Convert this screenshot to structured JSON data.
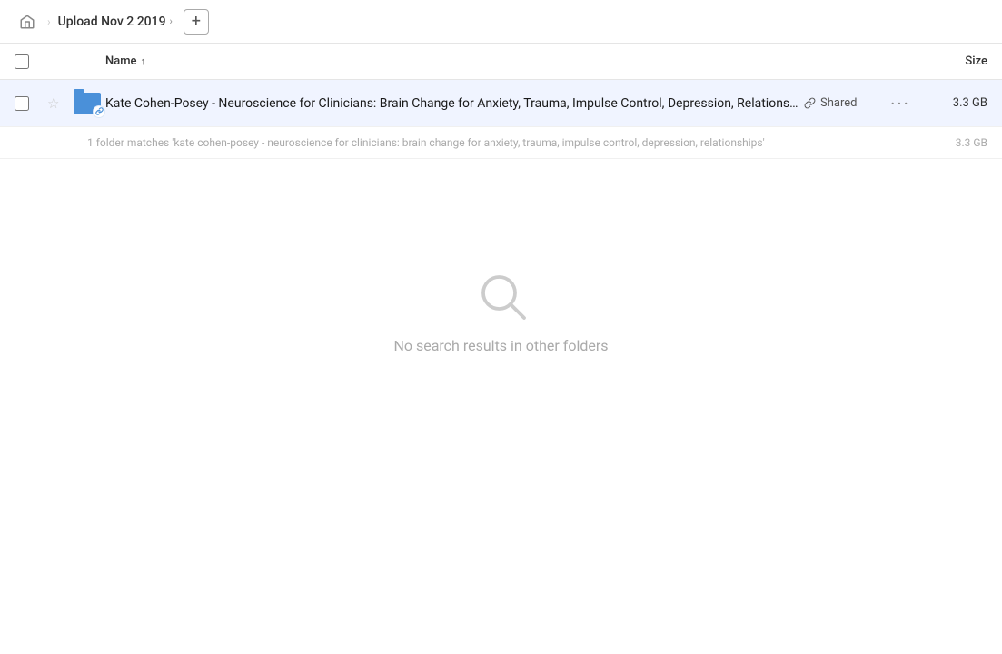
{
  "header": {
    "home_icon": "🏠",
    "breadcrumb": {
      "label": "Upload Nov 2 2019",
      "chevron": "›"
    },
    "add_button_label": "+"
  },
  "table": {
    "col_name_label": "Name",
    "col_name_sort": "↑",
    "col_size_label": "Size",
    "rows": [
      {
        "name": "Kate Cohen-Posey - Neuroscience for Clinicians: Brain Change for Anxiety, Trauma, Impulse Control, Depression, Relationships",
        "shared_label": "Shared",
        "size": "3.3 GB",
        "folder_type": "folder-link"
      }
    ],
    "match_note": "1 folder matches 'kate cohen-posey - neuroscience for clinicians: brain change for anxiety, trauma, impulse control, depression, relationships'",
    "match_note_size": "3.3 GB"
  },
  "empty_state": {
    "text": "No search results in other folders"
  },
  "icons": {
    "home": "⌂",
    "star_empty": "☆",
    "link": "🔗",
    "more": "•••"
  }
}
